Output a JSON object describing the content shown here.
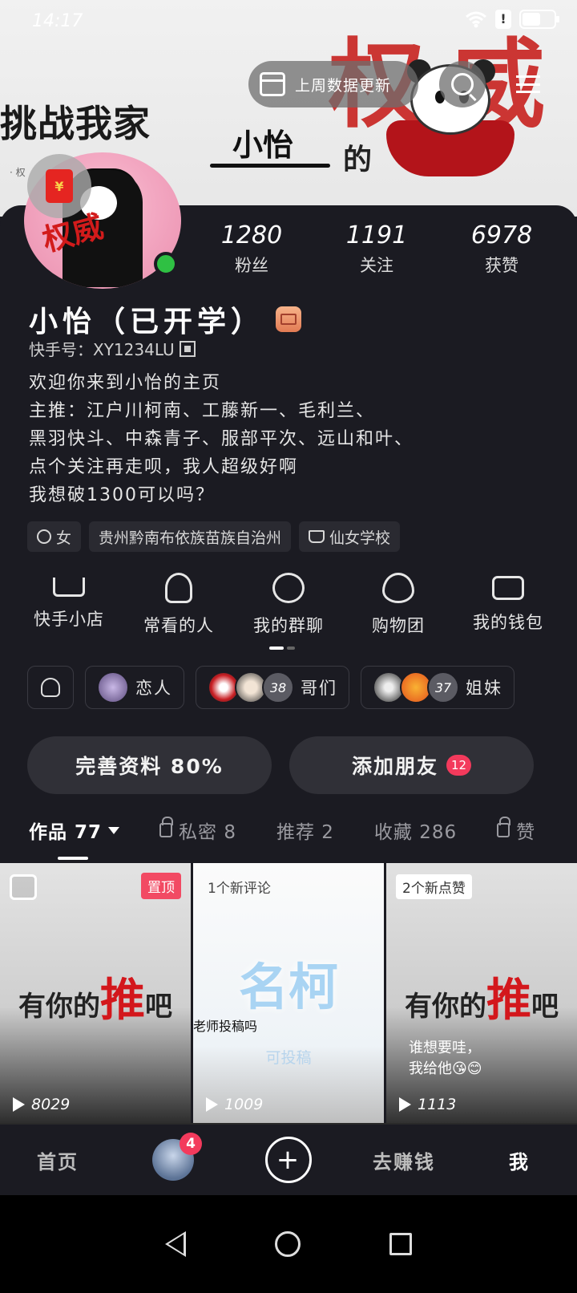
{
  "status_bar": {
    "time": "14:17",
    "alert": "!"
  },
  "banner": {
    "text_main": "挑战我家",
    "text_name": "小怡",
    "text_de": "的",
    "text_red": "权威",
    "text_small": "· 权"
  },
  "header": {
    "update_label": "上周数据更新",
    "search_icon": "search-icon",
    "menu_icon": "menu-icon"
  },
  "profile": {
    "avatar_text": "权威",
    "stats": [
      {
        "num": "1280",
        "label": "粉丝"
      },
      {
        "num": "1191",
        "label": "关注"
      },
      {
        "num": "6978",
        "label": "获赞"
      }
    ],
    "name": "小怡（已开学）",
    "kuaishou_id": "快手号：XY1234LU",
    "bio_lines": [
      "欢迎你来到小怡的主页",
      "主推：江户川柯南、工藤新一、毛利兰、",
      "黑羽快斗、中森青子、服部平次、远山和叶、",
      "点个关注再走呗，我人超级好啊",
      "我想破1300可以吗？"
    ],
    "tags": [
      {
        "icon": "gender-female-icon",
        "label": "女"
      },
      {
        "icon": "",
        "label": "贵州黔南布依族苗族自治州"
      },
      {
        "icon": "school-icon",
        "label": "仙女学校"
      }
    ]
  },
  "shortcuts": [
    {
      "icon": "shopping-cart-icon",
      "label": "快手小店"
    },
    {
      "icon": "person-clock-icon",
      "label": "常看的人"
    },
    {
      "icon": "group-chat-icon",
      "label": "我的群聊"
    },
    {
      "icon": "heart-icon",
      "label": "购物团"
    },
    {
      "icon": "wallet-icon",
      "label": "我的钱包"
    }
  ],
  "friend_groups": [
    {
      "label": "恋人"
    },
    {
      "label": "哥们",
      "count": "38"
    },
    {
      "label": "姐妹",
      "count": "37"
    }
  ],
  "actions": {
    "complete_profile": "完善资料 80%",
    "add_friends": "添加朋友",
    "add_friends_badge": "12"
  },
  "tabs": [
    {
      "label": "作品 77",
      "active": true
    },
    {
      "label": "私密 8",
      "locked": true
    },
    {
      "label": "推荐 2"
    },
    {
      "label": "收藏 286"
    },
    {
      "label": "赞",
      "locked": true
    }
  ],
  "videos": [
    {
      "art_prefix": "有你的",
      "art_red": "推",
      "art_suffix": "吧",
      "pin": "置顶",
      "plays": "8029"
    },
    {
      "notice": "1个新评论",
      "art": "名柯",
      "sub1": "老师投稿吗",
      "sub2": "可投稿",
      "plays": "1009"
    },
    {
      "notice": "2个新点赞",
      "art_prefix": "有你的",
      "art_red": "推",
      "art_suffix": "吧",
      "caption_1": "谁想要哇，",
      "caption_2": "我给他😘😊",
      "plays": "1113"
    }
  ],
  "bottom_nav": {
    "home": "首页",
    "friends_badge": "4",
    "plus": "+",
    "earn": "去赚钱",
    "me": "我"
  },
  "colors": {
    "background": "#1b1b22",
    "accent_red": "#f33a5c",
    "online_green": "#2fc043"
  }
}
